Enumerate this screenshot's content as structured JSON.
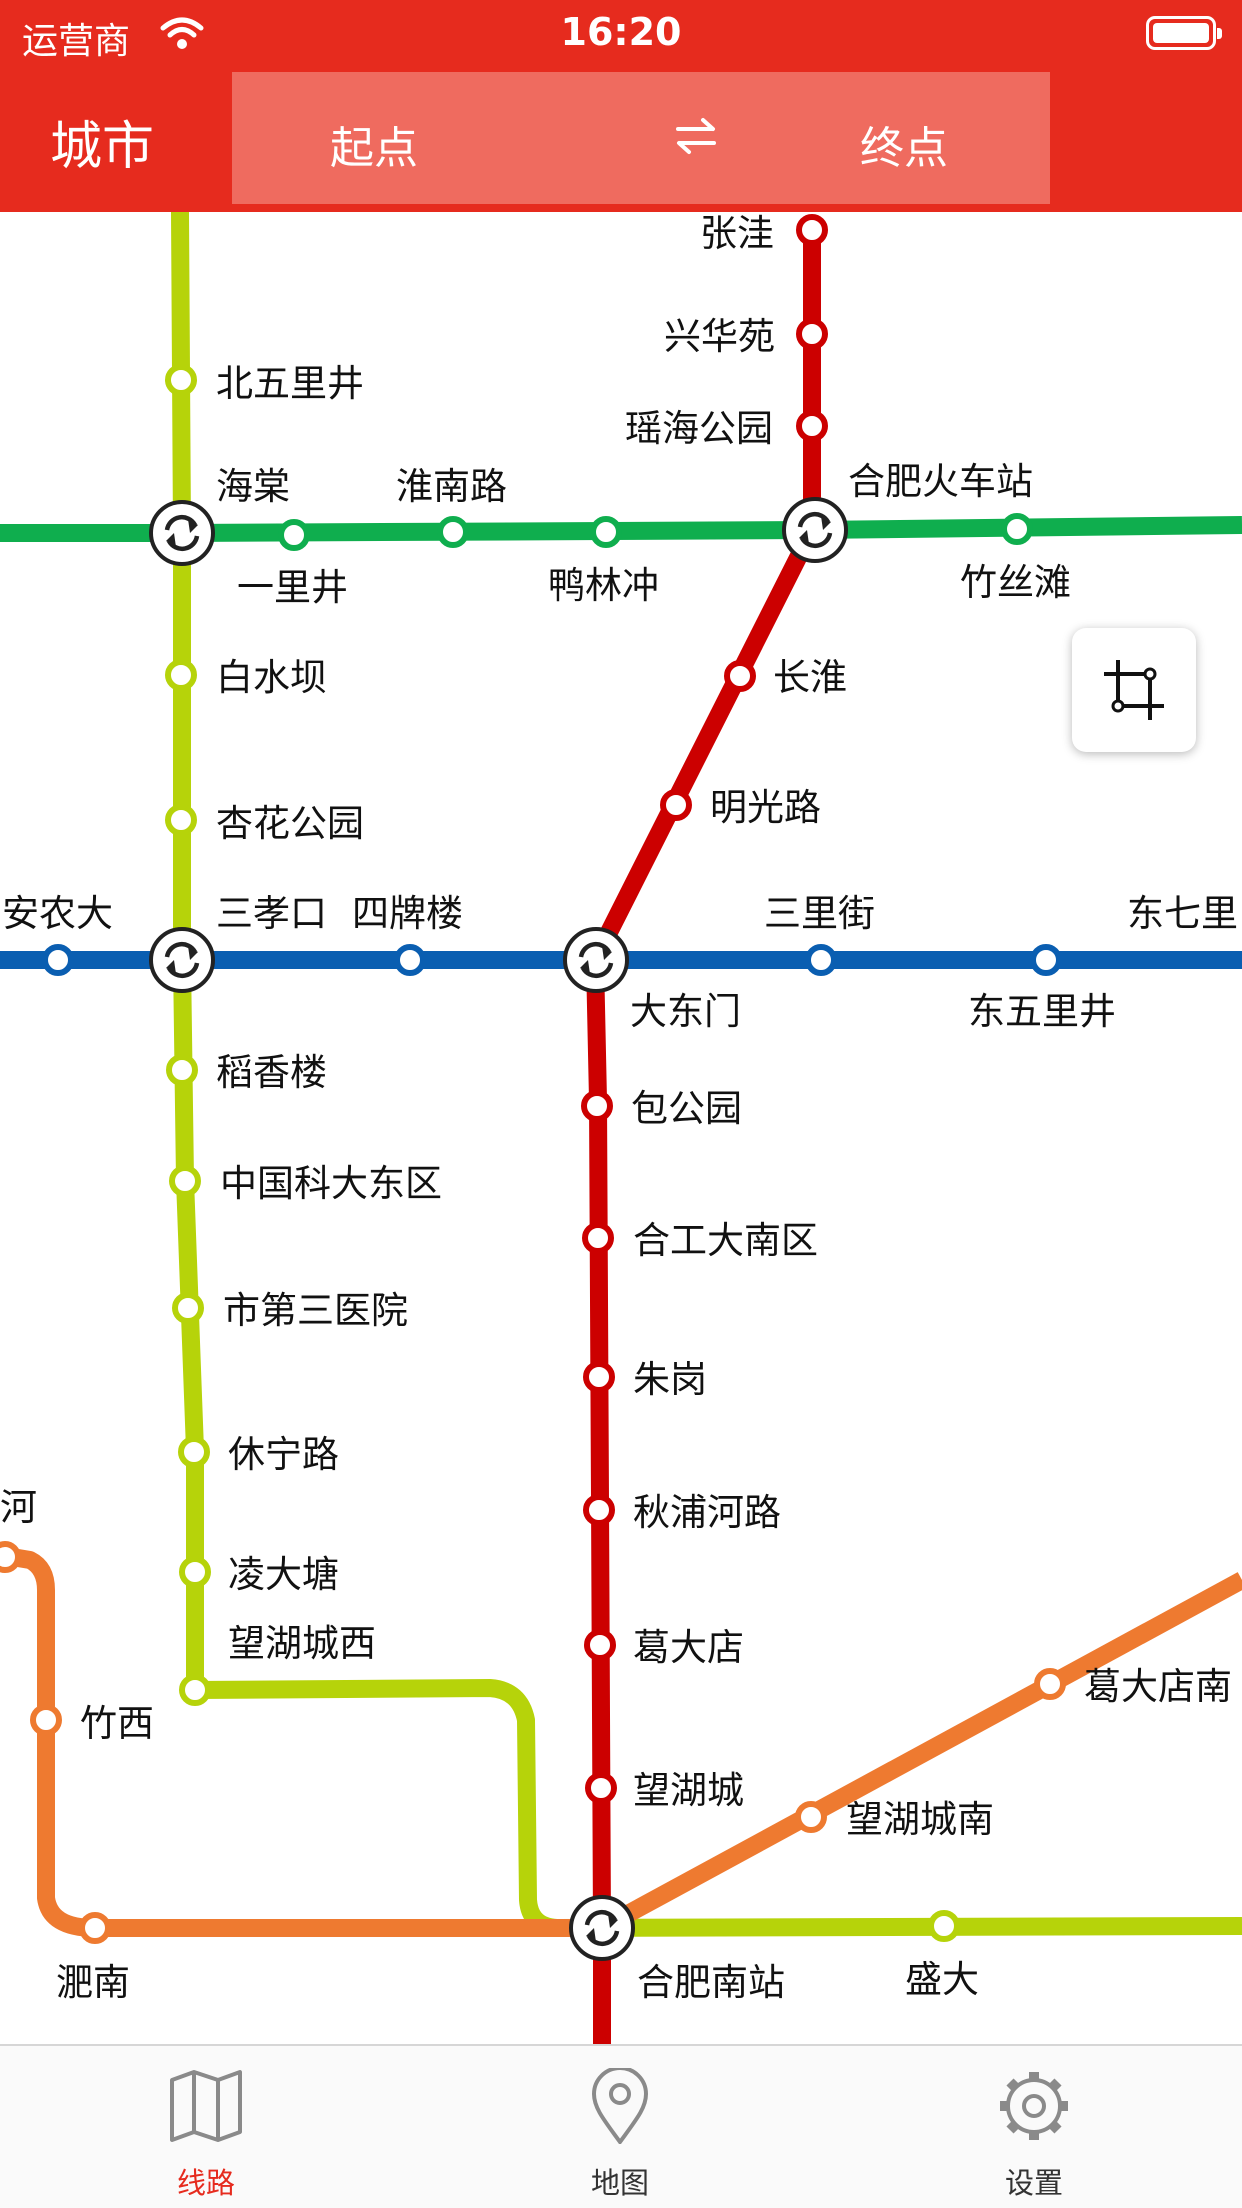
{
  "status_bar": {
    "carrier": "运营商",
    "time": "16:20"
  },
  "header": {
    "city": "城市",
    "origin": "起点",
    "destination": "终点"
  },
  "map": {
    "line_colors": {
      "red": "#cc0000",
      "lime": "#b6d30a",
      "green": "#0fae4e",
      "blue": "#0a5eb1",
      "orange": "#ee7a30"
    },
    "stations": {
      "zhangwa": "张洼",
      "xinghuayuan": "兴华苑",
      "yaohaigongyuan": "瑶海公园",
      "hefeihuochezhan": "合肥火车站",
      "zhusitan": "竹丝滩",
      "changhuai": "长淮",
      "mingguanglu": "明光路",
      "beiwulijing": "北五里井",
      "haitang": "海棠",
      "huainanlu": "淮南路",
      "yilijing": "一里井",
      "yalinchong": "鸭林冲",
      "baishuiba": "白水坝",
      "xinghuagongyuan": "杏花公园",
      "annongda": "安农大",
      "sanxiaokou": "三孝口",
      "sipailou": "四牌楼",
      "sanlijie": "三里街",
      "dongqili": "东七里",
      "dadongmen": "大东门",
      "dongwulijing": "东五里井",
      "daoxianglou": "稻香楼",
      "baogongyuan": "包公园",
      "zhongguokedadongqu": "中国科大东区",
      "hegongdananqu": "合工大南区",
      "shidisanyiyuan": "市第三医院",
      "zhugang": "朱岗",
      "xiuninglu": "休宁路",
      "qiupuhelu": "秋浦河路",
      "he": "河",
      "lingdatang": "凌大塘",
      "gedadian": "葛大店",
      "wanghuchengxi": "望湖城西",
      "gedadiannan": "葛大店南",
      "zhuxi": "竹西",
      "wanghucheng": "望湖城",
      "wanghuchengnan": "望湖城南",
      "feinan": "淝南",
      "hefeinanzhan": "合肥南站",
      "shengda": "盛大"
    }
  },
  "tabs": [
    {
      "label": "线路",
      "icon": "map-icon",
      "active": true
    },
    {
      "label": "地图",
      "icon": "location-pin-icon",
      "active": false
    },
    {
      "label": "设置",
      "icon": "gear-icon",
      "active": false
    }
  ]
}
